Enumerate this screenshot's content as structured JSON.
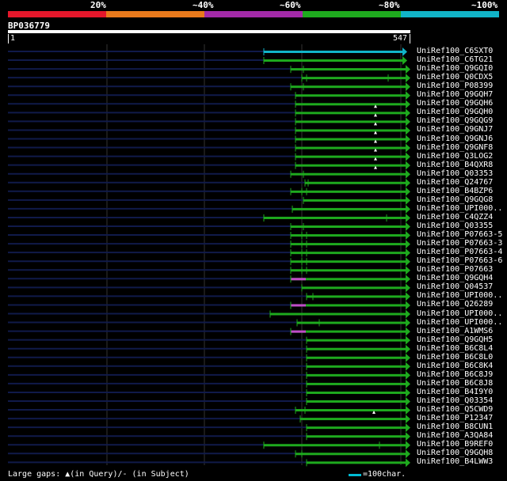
{
  "legend": {
    "colors": [
      "#e5172b",
      "#e97a1c",
      "#a32aa8",
      "#1eaa1e",
      "#11b4c8"
    ],
    "labels": [
      "20%",
      "~40%",
      "~60%",
      "~80%",
      "~100%"
    ]
  },
  "query": {
    "name": "BP036779",
    "start": "1",
    "end": "547"
  },
  "hits": [
    {
      "name": "UniRef100_C6SXT0",
      "s": 333,
      "e": 508,
      "color": "#11b4c8",
      "marks": []
    },
    {
      "name": "UniRef100_C6TG21",
      "s": 333,
      "e": 508,
      "color": "#1eaa1e",
      "marks": []
    },
    {
      "name": "UniRef100_Q9GQI0",
      "s": 367,
      "e": 512,
      "color": "#1eaa1e",
      "marks": [
        383
      ]
    },
    {
      "name": "UniRef100_Q0CDX5",
      "s": 381,
      "e": 512,
      "color": "#1eaa1e",
      "marks": [
        387,
        490
      ]
    },
    {
      "name": "UniRef100_P08399",
      "s": 367,
      "e": 512,
      "color": "#1eaa1e",
      "marks": [
        383
      ]
    },
    {
      "name": "UniRef100_Q9GQH7",
      "s": 373,
      "e": 512,
      "color": "#1eaa1e",
      "marks": []
    },
    {
      "name": "UniRef100_Q9GQH6",
      "s": 373,
      "e": 512,
      "color": "#1eaa1e",
      "marks": [],
      "tri": 474
    },
    {
      "name": "UniRef100_Q9GQH0",
      "s": 373,
      "e": 512,
      "color": "#1eaa1e",
      "marks": [],
      "tri": 474
    },
    {
      "name": "UniRef100_Q9GQG9",
      "s": 373,
      "e": 512,
      "color": "#1eaa1e",
      "marks": [],
      "tri": 474
    },
    {
      "name": "UniRef100_Q9GNJ7",
      "s": 373,
      "e": 512,
      "color": "#1eaa1e",
      "marks": [],
      "tri": 474
    },
    {
      "name": "UniRef100_Q9GNJ6",
      "s": 373,
      "e": 512,
      "color": "#1eaa1e",
      "marks": [],
      "tri": 474
    },
    {
      "name": "UniRef100_Q9GNF8",
      "s": 373,
      "e": 512,
      "color": "#1eaa1e",
      "marks": [],
      "tri": 474
    },
    {
      "name": "UniRef100_Q3LOG2",
      "s": 373,
      "e": 512,
      "color": "#1eaa1e",
      "marks": [],
      "tri": 474
    },
    {
      "name": "UniRef100_B4QXR8",
      "s": 373,
      "e": 512,
      "color": "#1eaa1e",
      "marks": [],
      "tri": 474
    },
    {
      "name": "UniRef100_Q03353",
      "s": 367,
      "e": 512,
      "color": "#1eaa1e",
      "marks": [
        383
      ]
    },
    {
      "name": "UniRef100_Q24767",
      "s": 385,
      "e": 512,
      "color": "#1eaa1e",
      "marks": [
        389
      ]
    },
    {
      "name": "UniRef100_B4BZP6",
      "s": 367,
      "e": 512,
      "color": "#1eaa1e",
      "marks": [
        381,
        387
      ]
    },
    {
      "name": "UniRef100_Q9GQG8",
      "s": 383,
      "e": 512,
      "color": "#1eaa1e",
      "marks": []
    },
    {
      "name": "UniRef100_UPI000..",
      "s": 369,
      "e": 512,
      "color": "#1eaa1e",
      "marks": []
    },
    {
      "name": "UniRef100_C4QZZ4",
      "s": 333,
      "e": 512,
      "color": "#1eaa1e",
      "marks": [
        488
      ]
    },
    {
      "name": "UniRef100_Q03355",
      "s": 367,
      "e": 512,
      "color": "#1eaa1e",
      "marks": [
        383
      ]
    },
    {
      "name": "UniRef100_P07663-5",
      "s": 367,
      "e": 512,
      "color": "#1eaa1e",
      "marks": [
        381,
        387
      ]
    },
    {
      "name": "UniRef100_P07663-3",
      "s": 367,
      "e": 512,
      "color": "#1eaa1e",
      "marks": [
        381,
        387
      ]
    },
    {
      "name": "UniRef100_P07663-4",
      "s": 367,
      "e": 512,
      "color": "#1eaa1e",
      "marks": [
        381,
        387
      ]
    },
    {
      "name": "UniRef100_P07663-6",
      "s": 367,
      "e": 512,
      "color": "#1eaa1e",
      "marks": [
        381,
        387
      ]
    },
    {
      "name": "UniRef100_P07663",
      "s": 367,
      "e": 512,
      "color": "#1eaa1e",
      "marks": [
        381,
        387
      ]
    },
    {
      "name": "UniRef100_Q9GQH4",
      "s": 367,
      "e": 512,
      "color": "#1eaa1e",
      "marks": [],
      "pink": [
        367,
        386
      ]
    },
    {
      "name": "UniRef100_Q04537",
      "s": 381,
      "e": 512,
      "color": "#1eaa1e",
      "marks": []
    },
    {
      "name": "UniRef100_UPI000..",
      "s": 387,
      "e": 512,
      "color": "#1eaa1e",
      "marks": [
        395
      ]
    },
    {
      "name": "UniRef100_Q26289",
      "s": 367,
      "e": 512,
      "color": "#1eaa1e",
      "marks": [],
      "pink": [
        367,
        386
      ]
    },
    {
      "name": "UniRef100_UPI000..",
      "s": 341,
      "e": 512,
      "color": "#1eaa1e",
      "marks": []
    },
    {
      "name": "UniRef100_UPI000..",
      "s": 375,
      "e": 512,
      "color": "#1eaa1e",
      "marks": [
        403
      ]
    },
    {
      "name": "UniRef100_A1WMS6",
      "s": 367,
      "e": 512,
      "color": "#1eaa1e",
      "marks": [],
      "pink": [
        367,
        386
      ]
    },
    {
      "name": "UniRef100_Q9GQH5",
      "s": 387,
      "e": 512,
      "color": "#1eaa1e",
      "marks": []
    },
    {
      "name": "UniRef100_B6C8L4",
      "s": 387,
      "e": 512,
      "color": "#1eaa1e",
      "marks": []
    },
    {
      "name": "UniRef100_B6C8L0",
      "s": 387,
      "e": 512,
      "color": "#1eaa1e",
      "marks": []
    },
    {
      "name": "UniRef100_B6C8K4",
      "s": 387,
      "e": 512,
      "color": "#1eaa1e",
      "marks": []
    },
    {
      "name": "UniRef100_B6C8J9",
      "s": 387,
      "e": 512,
      "color": "#1eaa1e",
      "marks": []
    },
    {
      "name": "UniRef100_B6C8J8",
      "s": 387,
      "e": 512,
      "color": "#1eaa1e",
      "marks": []
    },
    {
      "name": "UniRef100_B4I9Y0",
      "s": 387,
      "e": 512,
      "color": "#1eaa1e",
      "marks": []
    },
    {
      "name": "UniRef100_Q03354",
      "s": 387,
      "e": 512,
      "color": "#1eaa1e",
      "marks": []
    },
    {
      "name": "UniRef100_Q5CWD9",
      "s": 373,
      "e": 512,
      "color": "#1eaa1e",
      "marks": [
        385
      ],
      "tri": 472
    },
    {
      "name": "UniRef100_P12347",
      "s": 379,
      "e": 512,
      "color": "#1eaa1e",
      "marks": []
    },
    {
      "name": "UniRef100_B8CUN1",
      "s": 387,
      "e": 512,
      "color": "#1eaa1e",
      "marks": []
    },
    {
      "name": "UniRef100_A3QA84",
      "s": 387,
      "e": 512,
      "color": "#1eaa1e",
      "marks": []
    },
    {
      "name": "UniRef100_B9REF0",
      "s": 333,
      "e": 512,
      "color": "#1eaa1e",
      "marks": [
        479
      ]
    },
    {
      "name": "UniRef100_Q9GQH8",
      "s": 373,
      "e": 512,
      "color": "#1eaa1e",
      "marks": [
        381
      ]
    },
    {
      "name": "UniRef100_B4LWW3",
      "s": 387,
      "e": 512,
      "color": "#1eaa1e",
      "marks": []
    }
  ],
  "footer": {
    "text": "Large gaps: ▲(in Query)/- (in Subject)"
  },
  "scale": {
    "text": "=100char."
  }
}
